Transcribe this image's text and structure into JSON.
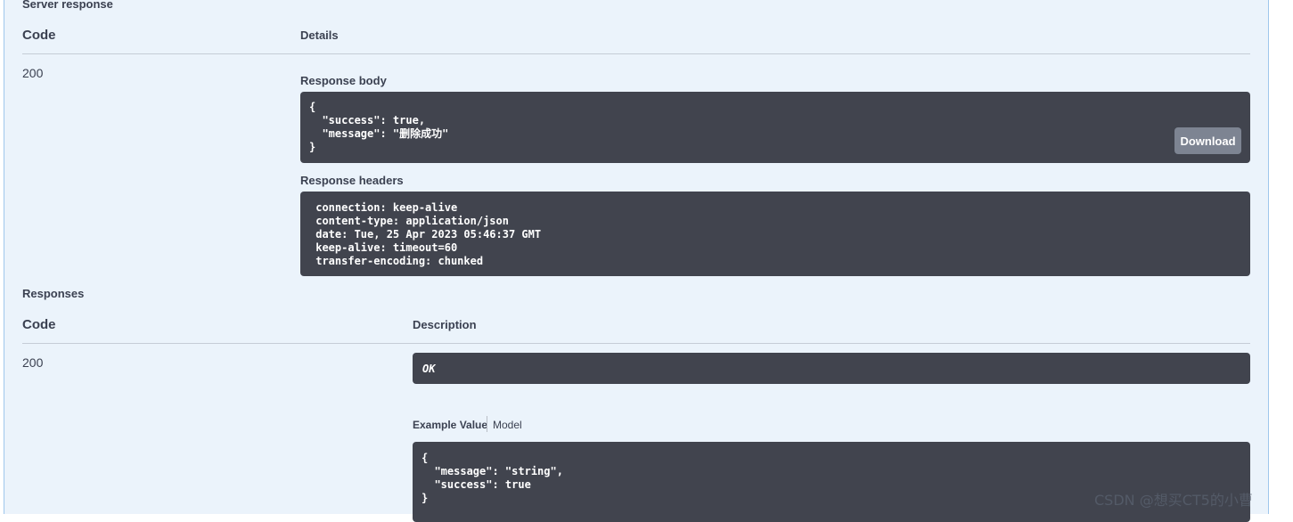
{
  "server_response": {
    "title": "Server response",
    "code_header": "Code",
    "details_header": "Details",
    "code": "200",
    "response_body_label": "Response body",
    "response_body_lines": [
      "{",
      "  \"success\": true,",
      "  \"message\": \"删除成功\"",
      "}"
    ],
    "download_label": "Download",
    "response_headers_label": "Response headers",
    "response_headers_lines": [
      " connection: keep-alive",
      " content-type: application/json",
      " date: Tue, 25 Apr 2023 05:46:37 GMT",
      " keep-alive: timeout=60",
      " transfer-encoding: chunked"
    ]
  },
  "responses": {
    "title": "Responses",
    "code_header": "Code",
    "description_header": "Description",
    "code": "200",
    "description": "OK",
    "tabs": [
      {
        "label": "Example Value",
        "active": true
      },
      {
        "label": "Model",
        "active": false
      }
    ],
    "example_lines": [
      "{",
      "  \"message\": \"string\",",
      "  \"success\": true",
      "}"
    ]
  },
  "watermark": "CSDN @想买CT5的小曹"
}
